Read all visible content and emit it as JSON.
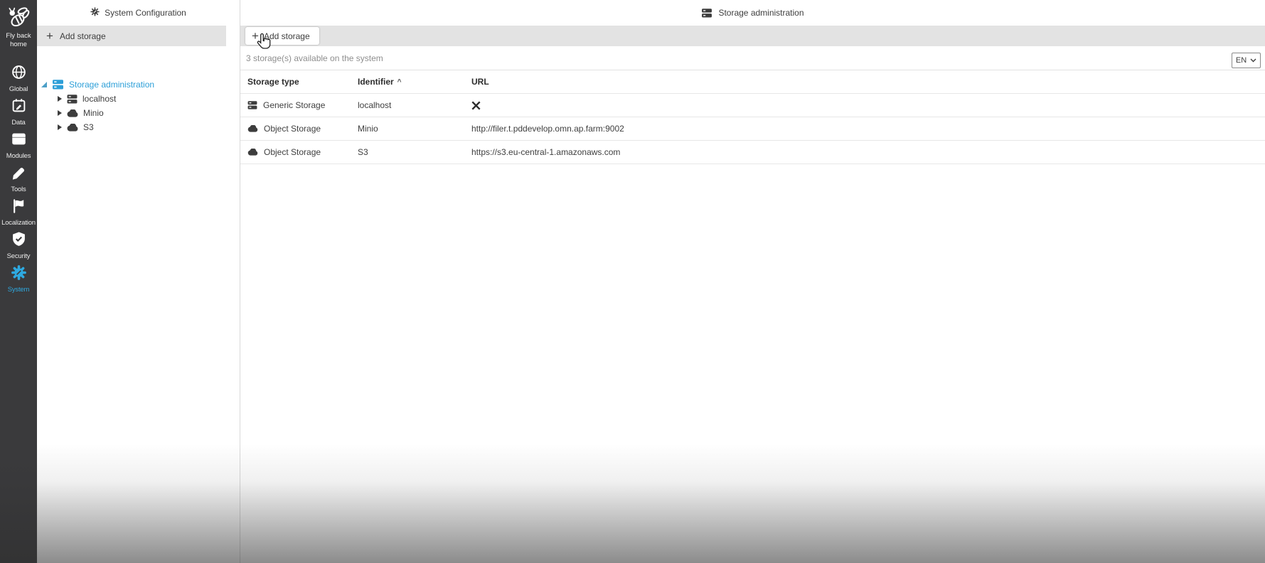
{
  "icons": {
    "plus": "+"
  },
  "sidebar": {
    "logo": {
      "label_line1": "Fly back",
      "label_line2": "home"
    },
    "items": [
      {
        "label": "Global",
        "icon": "globe-icon"
      },
      {
        "label": "Data",
        "icon": "calendar-edit-icon"
      },
      {
        "label": "Modules",
        "icon": "window-icon"
      },
      {
        "label": "Tools",
        "icon": "pencil-icon"
      },
      {
        "label": "Localization",
        "icon": "flag-icon"
      },
      {
        "label": "Security",
        "icon": "shield-check-icon"
      },
      {
        "label": "System",
        "icon": "gear-icon",
        "active": true
      }
    ]
  },
  "panel": {
    "title": "System Configuration",
    "toolbar": {
      "add_storage_label": "Add storage"
    },
    "tree": {
      "root": {
        "label": "Storage administration",
        "selected": true,
        "icon": "server-stack-icon"
      },
      "children": [
        {
          "label": "localhost",
          "icon": "server-stack-icon"
        },
        {
          "label": "Minio",
          "icon": "cloud-icon"
        },
        {
          "label": "S3",
          "icon": "cloud-icon"
        }
      ]
    }
  },
  "main": {
    "title": "Storage administration",
    "toolbar": {
      "add_storage_label": "Add storage"
    },
    "status_text": "3 storage(s) available on the system",
    "language_selector": {
      "value": "EN"
    },
    "table": {
      "headers": {
        "type": "Storage type",
        "identifier": "Identifier",
        "url": "URL"
      },
      "sort_column": "Identifier",
      "sort_indicator": "^",
      "rows": [
        {
          "type": "Generic Storage",
          "icon": "server-stack-icon",
          "identifier": "localhost",
          "url": ""
        },
        {
          "type": "Object Storage",
          "icon": "cloud-icon",
          "identifier": "Minio",
          "url": "http://filer.t.pddevelop.omn.ap.farm:9002"
        },
        {
          "type": "Object Storage",
          "icon": "cloud-icon",
          "identifier": "S3",
          "url": "https://s3.eu-central-1.amazonaws.com"
        }
      ]
    }
  },
  "colors": {
    "accent_blue": "#2d9fd8",
    "active_icon_blue": "#2ea9e0",
    "sidebar_bg": "#3a3a3c",
    "toolbar_gray": "#e3e3e3"
  }
}
